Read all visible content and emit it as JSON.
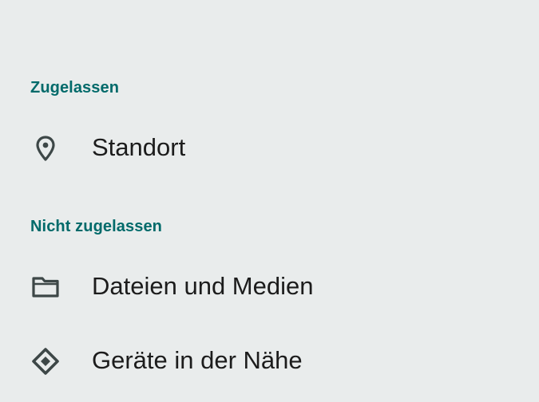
{
  "sections": [
    {
      "header": "Zugelassen",
      "items": [
        {
          "label": "Standort",
          "icon": "location-pin-icon"
        }
      ]
    },
    {
      "header": "Nicht zugelassen",
      "items": [
        {
          "label": "Dateien und Medien",
          "icon": "folder-icon"
        },
        {
          "label": "Geräte in der Nähe",
          "icon": "nearby-devices-icon"
        }
      ]
    }
  ],
  "colors": {
    "background": "#e9ecec",
    "accent": "#006a6a",
    "text": "#1c1c1c",
    "icon": "#3d4747"
  }
}
